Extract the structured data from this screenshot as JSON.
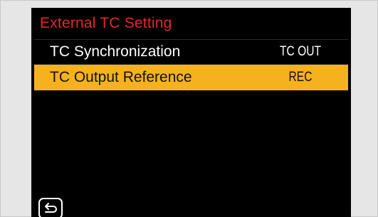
{
  "menu": {
    "title": "External TC Setting",
    "items": [
      {
        "label": "TC Synchronization",
        "value": "TC OUT"
      },
      {
        "label": "TC Output Reference",
        "value": "REC",
        "selected": true
      }
    ]
  },
  "controls": {
    "back_icon": "return-arrow-icon"
  },
  "colors": {
    "title": "#e8262a",
    "highlight": "#f5b21e",
    "screen_background": "#000000",
    "frame": "#e6e6e6"
  }
}
